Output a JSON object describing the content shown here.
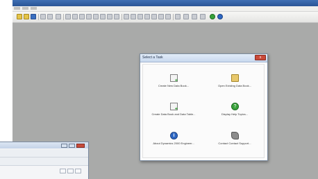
{
  "app": {
    "title": "",
    "menu": [
      "",
      "",
      ""
    ]
  },
  "toolbar": {
    "icons": [
      "new-icon",
      "open-icon",
      "save-icon",
      "print-icon",
      "first-icon",
      "prev-icon",
      "next-icon",
      "last-icon",
      "grid-icon",
      "chart-icon",
      "lock-icon",
      "help-icon",
      "info-icon"
    ]
  },
  "dialog": {
    "title": "Select a Task",
    "close_label": "x",
    "tasks": [
      {
        "label": "Create New Data Book...",
        "icon": "new-data-book-icon"
      },
      {
        "label": "Open Existing Data Book...",
        "icon": "open-folder-icon"
      },
      {
        "label": "Create Data Book and Data Table...",
        "icon": "new-data-table-icon"
      },
      {
        "label": "Display Help Topics...",
        "icon": "help-icon"
      },
      {
        "label": "About Dynamics 2000 Engineer...",
        "icon": "info-icon"
      },
      {
        "label": "Contact Contact Support...",
        "icon": "support-icon"
      }
    ]
  },
  "colors": {
    "workspace": "#a9aaa9",
    "titlebar": "#2a5596",
    "help_green": "#3aa33c",
    "info_blue": "#2f68c4"
  }
}
